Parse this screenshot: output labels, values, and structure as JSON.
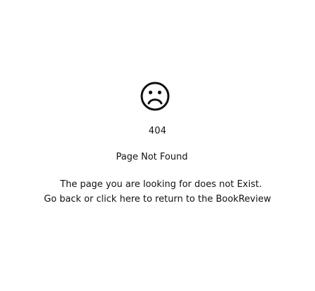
{
  "error": {
    "icon": "sad-face-icon",
    "code": "404",
    "title": "Page Not Found",
    "message_line1": "The page you are looking for does not Exist.",
    "message_line2": "Go back or click here to return to the BookReview"
  },
  "colors": {
    "background": "#ffffff",
    "text": "#111111"
  }
}
